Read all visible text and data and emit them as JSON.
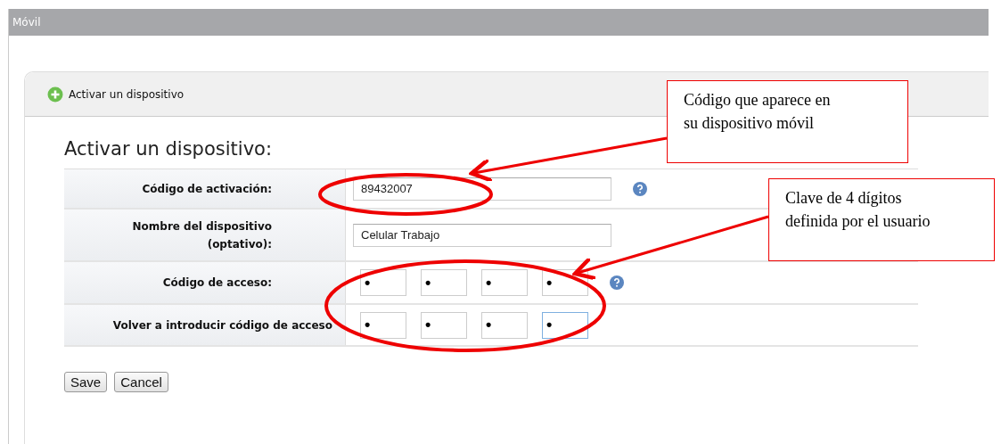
{
  "window": {
    "title": "Móvil"
  },
  "panel": {
    "tab_label": "Activar un dispositivo",
    "heading": "Activar un dispositivo:"
  },
  "form": {
    "rows": [
      {
        "kind": "text",
        "label": "Código de activación:",
        "value": "89432007",
        "help": true
      },
      {
        "kind": "text",
        "label": "Nombre del dispositivo (optativo):",
        "value": "Celular Trabajo",
        "help": false
      },
      {
        "kind": "pin",
        "label": "Código de acceso:",
        "digits": [
          {
            "value": "•",
            "focused": false
          },
          {
            "value": "•",
            "focused": false
          },
          {
            "value": "•",
            "focused": false
          },
          {
            "value": "•",
            "focused": false
          }
        ],
        "help": true
      },
      {
        "kind": "pin",
        "label": "Volver a introducir código de acceso",
        "digits": [
          {
            "value": "•",
            "focused": false
          },
          {
            "value": "•",
            "focused": false
          },
          {
            "value": "•",
            "focused": false
          },
          {
            "value": "•",
            "focused": true
          }
        ],
        "help": false
      }
    ]
  },
  "buttons": [
    "Save",
    "Cancel"
  ],
  "annotations": [
    {
      "lines": [
        "Código que aparece en",
        "su dispositivo móvil"
      ]
    },
    {
      "lines": [
        "Clave de 4 dígitos",
        "definida por el usuario"
      ]
    }
  ]
}
